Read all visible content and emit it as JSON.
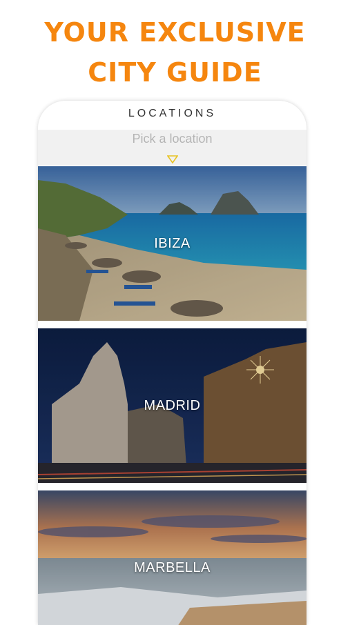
{
  "headline": {
    "line1": "YOUR EXCLUSIVE",
    "line2": "CITY GUIDE"
  },
  "header": {
    "title": "LOCATIONS"
  },
  "picker": {
    "placeholder": "Pick a location",
    "icon": "triangle-down-icon"
  },
  "locations": [
    {
      "name": "IBIZA"
    },
    {
      "name": "MADRID"
    },
    {
      "name": "MARBELLA"
    }
  ],
  "colors": {
    "accent": "#f5860f",
    "picker_bg": "#f1f1f1",
    "caret": "#e8c322"
  }
}
